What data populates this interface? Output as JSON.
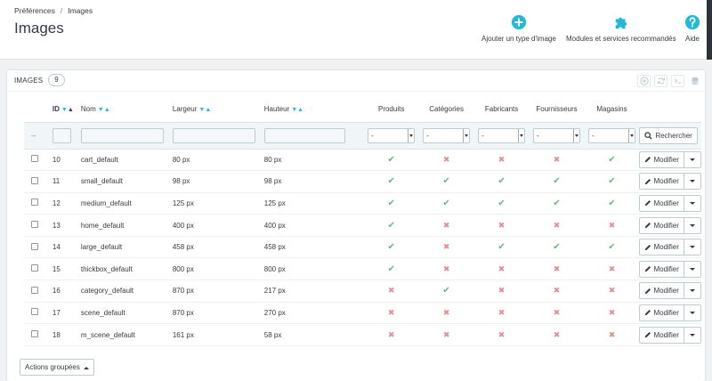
{
  "breadcrumb": {
    "parent": "Préférences",
    "separator": "/",
    "current": "Images"
  },
  "page_title": "Images",
  "toolbar": {
    "add_label": "Ajouter un type d'image",
    "modules_label": "Modules et services recommandés",
    "help_label": "Aide",
    "icon_color": "#25b9d7"
  },
  "panel": {
    "title": "Images",
    "count": "9"
  },
  "columns": {
    "id": "ID",
    "name": "Nom",
    "width": "Largeur",
    "height": "Hauteur",
    "products": "Produits",
    "categories": "Catégories",
    "manufacturers": "Fabricants",
    "suppliers": "Fournisseurs",
    "stores": "Magasins"
  },
  "filters": {
    "bulk_placeholder": "--",
    "select_value": "-",
    "search_label": "Rechercher"
  },
  "row_action": "Modifier",
  "rows": [
    {
      "id": "10",
      "name": "cart_default",
      "width": "80 px",
      "height": "80 px",
      "flags": [
        true,
        false,
        false,
        false,
        true
      ]
    },
    {
      "id": "11",
      "name": "small_default",
      "width": "98 px",
      "height": "98 px",
      "flags": [
        true,
        true,
        true,
        true,
        true
      ]
    },
    {
      "id": "12",
      "name": "medium_default",
      "width": "125 px",
      "height": "125 px",
      "flags": [
        true,
        true,
        true,
        true,
        true
      ]
    },
    {
      "id": "13",
      "name": "home_default",
      "width": "400 px",
      "height": "400 px",
      "flags": [
        true,
        false,
        false,
        false,
        false
      ]
    },
    {
      "id": "14",
      "name": "large_default",
      "width": "458 px",
      "height": "458 px",
      "flags": [
        true,
        false,
        true,
        true,
        true
      ]
    },
    {
      "id": "15",
      "name": "thickbox_default",
      "width": "800 px",
      "height": "800 px",
      "flags": [
        true,
        false,
        false,
        false,
        false
      ]
    },
    {
      "id": "16",
      "name": "category_default",
      "width": "870 px",
      "height": "217 px",
      "flags": [
        false,
        true,
        false,
        false,
        false
      ]
    },
    {
      "id": "17",
      "name": "scene_default",
      "width": "870 px",
      "height": "270 px",
      "flags": [
        false,
        false,
        false,
        false,
        false
      ]
    },
    {
      "id": "18",
      "name": "m_scene_default",
      "width": "161 px",
      "height": "58 px",
      "flags": [
        false,
        false,
        false,
        false,
        false
      ]
    }
  ],
  "bulk_actions_label": "Actions groupées",
  "colors": {
    "check": "#70b580",
    "cross": "#e08f95",
    "accent": "#25b9d7"
  }
}
